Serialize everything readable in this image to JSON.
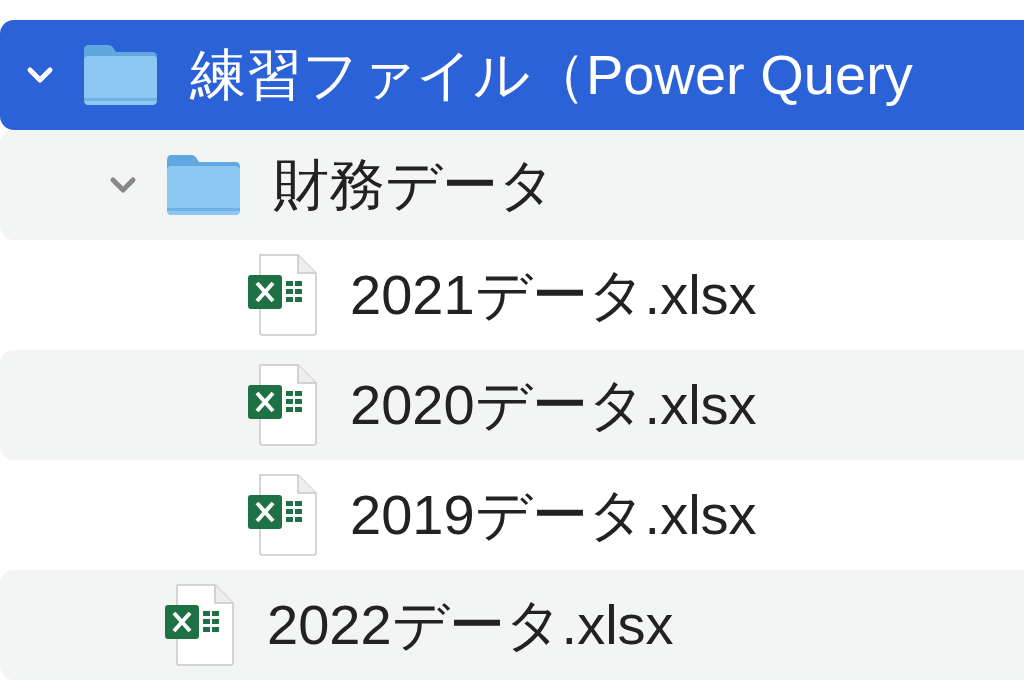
{
  "tree": [
    {
      "name": "練習ファイル（Power Query",
      "kind": "folder",
      "expanded": true,
      "selected": true,
      "children": [
        {
          "name": "財務データ",
          "kind": "folder",
          "expanded": true,
          "selected": false,
          "children": [
            {
              "name": "2021データ.xlsx",
              "kind": "file",
              "selected": false
            },
            {
              "name": "2020データ.xlsx",
              "kind": "file",
              "selected": false
            },
            {
              "name": "2019データ.xlsx",
              "kind": "file",
              "selected": false
            }
          ]
        },
        {
          "name": "2022データ.xlsx",
          "kind": "file",
          "selected": false
        }
      ]
    }
  ]
}
